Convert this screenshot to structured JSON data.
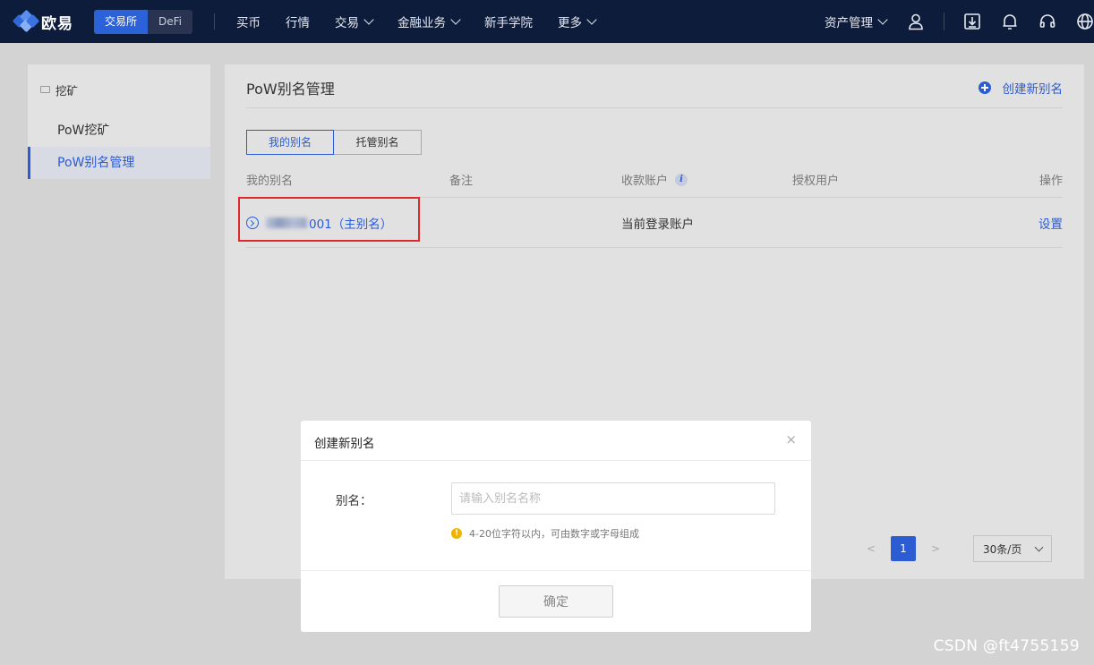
{
  "brand": {
    "name": "欧易"
  },
  "mode_switch": {
    "exchange": "交易所",
    "defi": "DeFi"
  },
  "nav": {
    "items": [
      {
        "label": "买币",
        "has_menu": false
      },
      {
        "label": "行情",
        "has_menu": false
      },
      {
        "label": "交易",
        "has_menu": true
      },
      {
        "label": "金融业务",
        "has_menu": true
      },
      {
        "label": "新手学院",
        "has_menu": false
      },
      {
        "label": "更多",
        "has_menu": true
      }
    ],
    "asset_mgmt": "资产管理",
    "icons": [
      "user-icon",
      "download-icon",
      "bell-icon",
      "headset-icon",
      "globe-icon"
    ]
  },
  "sidebar": {
    "group": "挖矿",
    "items": [
      {
        "label": "PoW挖矿",
        "active": false
      },
      {
        "label": "PoW别名管理",
        "active": true
      }
    ]
  },
  "main": {
    "title": "PoW别名管理",
    "create_link": "创建新别名",
    "tabs": [
      {
        "label": "我的别名",
        "active": true
      },
      {
        "label": "托管别名",
        "active": false
      }
    ],
    "columns": [
      "我的别名",
      "备注",
      "收款账户",
      "授权用户",
      "操作"
    ],
    "info_icon": "i",
    "rows": [
      {
        "alias_suffix": "001（主别名）",
        "note": "",
        "account": "当前登录账户",
        "users": "",
        "action": "设置"
      }
    ]
  },
  "pagination": {
    "prev": "<",
    "page": "1",
    "next": ">",
    "page_size": "30条/页"
  },
  "modal": {
    "title": "创建新别名",
    "close": "×",
    "field_label": "别名：",
    "field_placeholder": "请输入别名名称",
    "field_value": "",
    "hint_icon": "!",
    "hint": "4-20位字符以内，可由数字或字母组成",
    "confirm": "确定"
  },
  "watermark": "CSDN @ft4755159",
  "colors": {
    "nav_bg": "#0e1c3c",
    "accent": "#2b5cd4",
    "highlight": "#e02a2a",
    "warn": "#f0b400"
  }
}
